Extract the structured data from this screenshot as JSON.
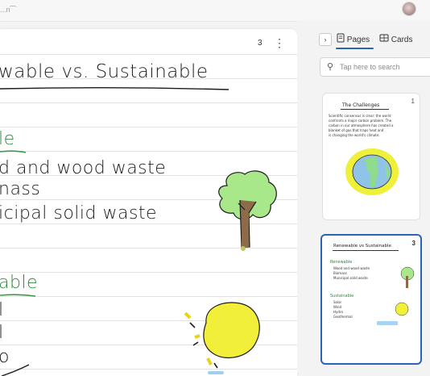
{
  "app": {
    "title": "...n",
    "avatar": "user-avatar"
  },
  "note": {
    "page_number": "3",
    "more_icon": "⋮",
    "lines": [
      "wable vs. Sustainable",
      "le",
      "d and wood waste",
      "nass",
      "icipal solid waste",
      "able",
      "l",
      "l",
      "o"
    ]
  },
  "panel": {
    "collapse_icon": "›",
    "tabs": [
      {
        "label": "Pages"
      },
      {
        "label": "Cards"
      }
    ],
    "search": {
      "placeholder": "Tap here to search"
    },
    "thumbnails": [
      {
        "number": "1",
        "title": "The Challenges",
        "lines": [
          "Scientific consensus is clear: the world",
          "confronts a major carbon problem. The",
          "carbon in our atmosphere has created a",
          "blanket of gas that traps heat and",
          "is changing the world's climate."
        ]
      },
      {
        "number": "3",
        "title": "Renewable vs Sustainable",
        "sections": [
          {
            "heading": "Renewable",
            "items": [
              "Wood and wood waste",
              "Biomass",
              "Municipal solid waste"
            ]
          },
          {
            "heading": "Sustainable",
            "items": [
              "Solar",
              "Wind",
              "Hydro",
              "Geothermal"
            ]
          }
        ]
      }
    ]
  },
  "colors": {
    "accent": "#2b63b7",
    "ink_green": "#3a9a4a",
    "tree_green": "#a8e88a",
    "sun_yellow": "#f1ef3a",
    "earth_blue": "#8fc3e8"
  }
}
